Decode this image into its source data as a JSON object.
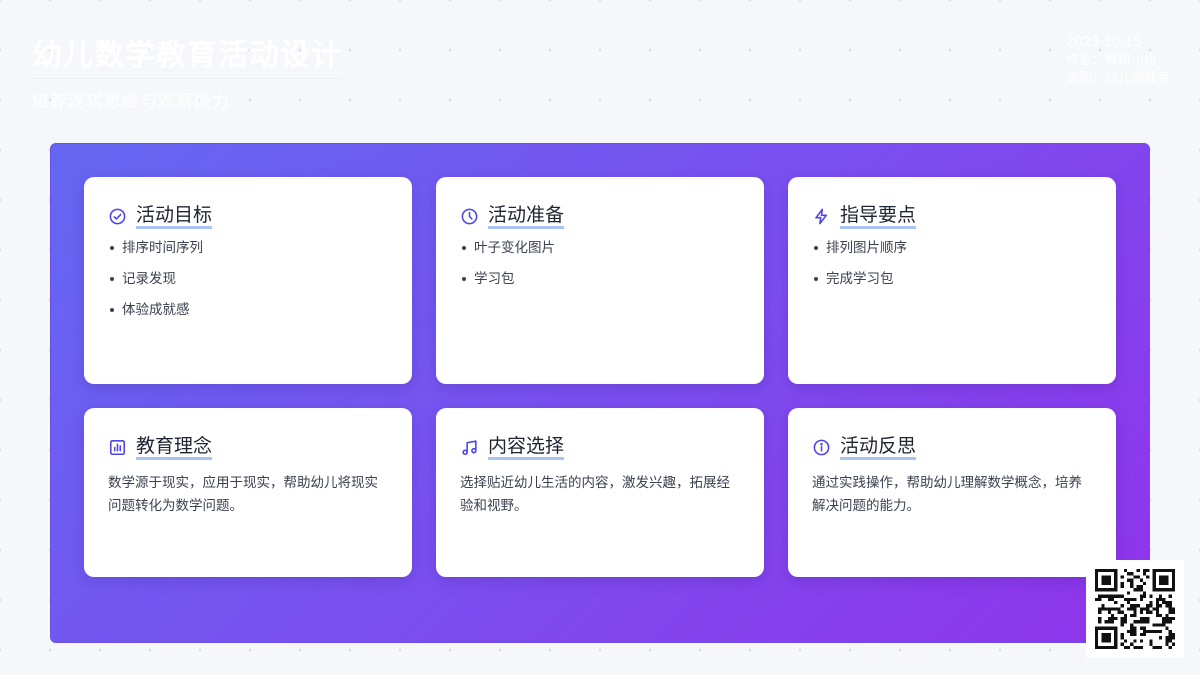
{
  "header": {
    "title": "幼儿数学教育活动设计",
    "subtitle": "培养逻辑思维与观察能力"
  },
  "meta": {
    "date": "2023-10-15",
    "author": "作者：教研小组",
    "category": "类别：幼儿园教育"
  },
  "colors": {
    "accent": "#4f46e5",
    "underline": "#a9c3f3",
    "panel_start": "#6467f2",
    "panel_end": "#9033ea"
  },
  "cards": [
    {
      "icon": "check-circle-icon",
      "title": "活动目标",
      "items": [
        "排序时间序列",
        "记录发现",
        "体验成就感"
      ]
    },
    {
      "icon": "clock-icon",
      "title": "活动准备",
      "items": [
        "叶子变化图片",
        "学习包"
      ]
    },
    {
      "icon": "lightning-icon",
      "title": "指导要点",
      "items": [
        "排列图片顺序",
        "完成学习包"
      ]
    },
    {
      "icon": "bar-chart-icon",
      "title": "教育理念",
      "text": "数学源于现实，应用于现实，帮助幼儿将现实问题转化为数学问题。"
    },
    {
      "icon": "music-note-icon",
      "title": "内容选择",
      "text": "选择贴近幼儿生活的内容，激发兴趣，拓展经验和视野。"
    },
    {
      "icon": "info-circle-icon",
      "title": "活动反思",
      "text": "通过实践操作，帮助幼儿理解数学概念，培养解决问题的能力。"
    }
  ],
  "qr": {
    "icon": "qr-code-icon"
  }
}
